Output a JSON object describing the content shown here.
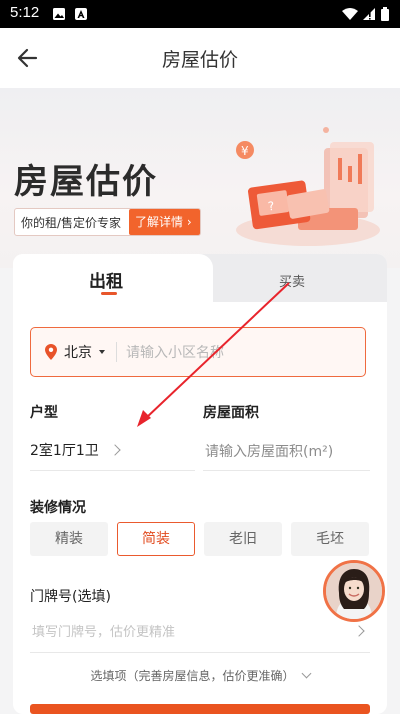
{
  "status_bar": {
    "time": "5:12"
  },
  "app_bar": {
    "title": "房屋估价"
  },
  "hero": {
    "title": "房屋估价",
    "tagline": "你的租/售定价专家",
    "details_button": "了解详情",
    "coin_symbol": "¥"
  },
  "tabs": [
    {
      "label": "出租",
      "active": true
    },
    {
      "label": "买卖",
      "active": false
    }
  ],
  "address": {
    "city": "北京",
    "placeholder": "请输入小区名称"
  },
  "layout_field": {
    "label": "户型",
    "value": "2室1厅1卫"
  },
  "area_field": {
    "label": "房屋面积",
    "placeholder": "请输入房屋面积(m²)"
  },
  "decoration": {
    "label": "装修情况",
    "options": [
      "精装",
      "简装",
      "老旧",
      "毛坯"
    ],
    "selected": "简装"
  },
  "door_number": {
    "label": "门牌号(选填)",
    "placeholder": "填写门牌号，估价更精准"
  },
  "optional_items": {
    "label": "选填项（完善房屋信息，估价更准确）"
  },
  "colors": {
    "accent": "#ea5a2e",
    "arrow": "#e8242c"
  },
  "icons": [
    "back-arrow-icon",
    "location-pin-icon",
    "chevron-right-icon",
    "chevron-down-icon",
    "wifi-icon",
    "signal-icon",
    "battery-icon",
    "image-icon",
    "notification-icon"
  ]
}
